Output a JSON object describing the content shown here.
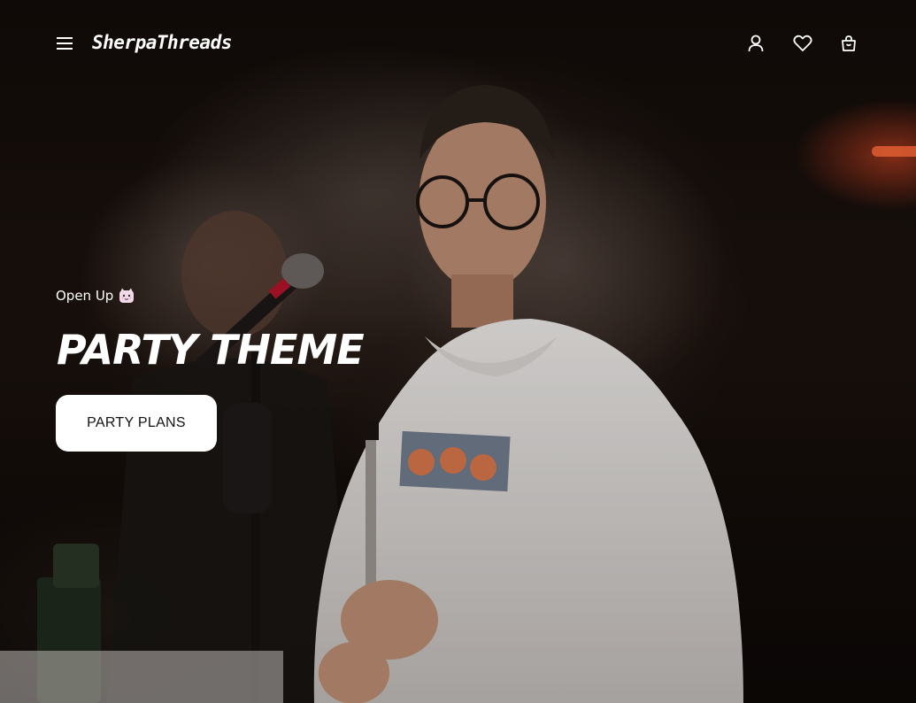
{
  "header": {
    "logo": "SherpaThreads",
    "menu_icon": "hamburger-menu-icon",
    "account_icon": "user-icon",
    "wishlist_icon": "heart-icon",
    "cart_icon": "shopping-bag-icon"
  },
  "hero": {
    "eyebrow": "Open Up",
    "eyebrow_icon": "cat-face-emoji-icon",
    "headline": "PARTY THEME",
    "cta_label": "PARTY PLANS"
  },
  "colors": {
    "text": "#ffffff",
    "button_bg": "#ffffff",
    "button_text": "#111111",
    "background": "#120c09"
  }
}
